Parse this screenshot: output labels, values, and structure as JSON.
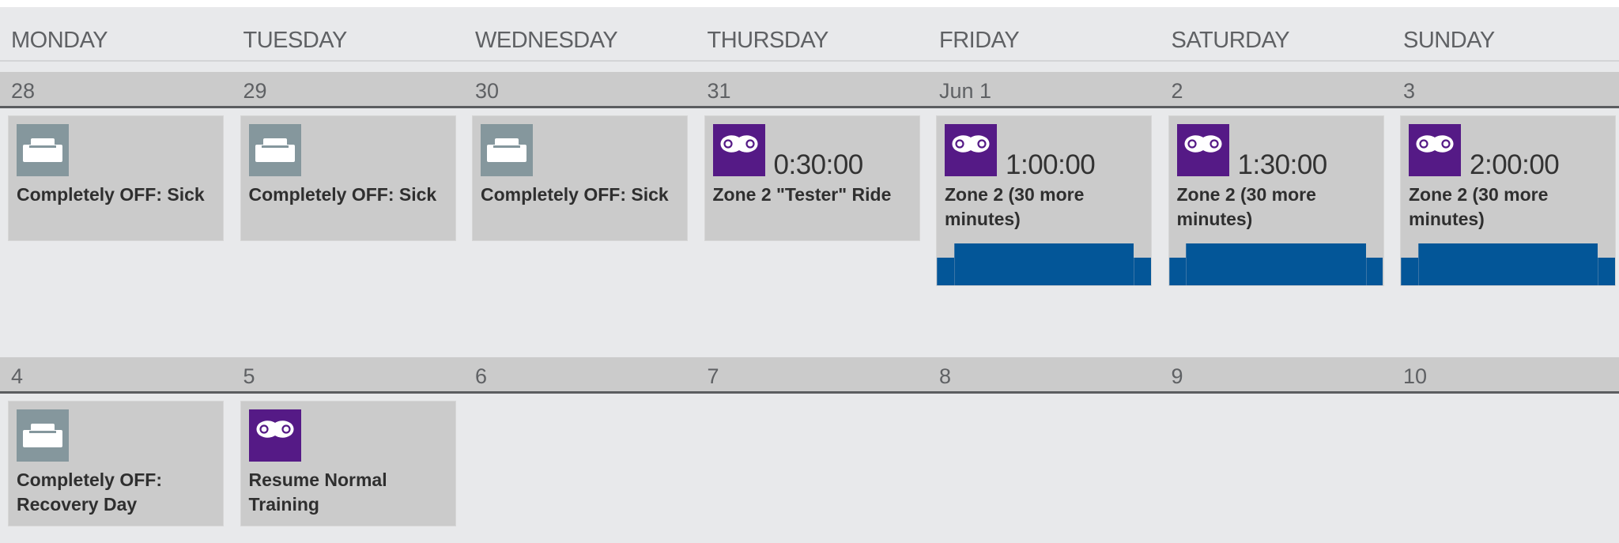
{
  "colors": {
    "rest_icon_bg": "#85979d",
    "bike_icon_bg": "#551a86",
    "workout_graph": "#035698",
    "card_bg": "#cbcbcb",
    "page_bg": "#e8e9eb"
  },
  "header": {
    "days": [
      "MONDAY",
      "TUESDAY",
      "WEDNESDAY",
      "THURSDAY",
      "FRIDAY",
      "SATURDAY",
      "SUNDAY"
    ]
  },
  "weeks": [
    {
      "dates": [
        "28",
        "29",
        "30",
        "31",
        "Jun 1",
        "2",
        "3"
      ],
      "workouts": [
        {
          "day": 0,
          "type": "rest",
          "icon": "couch-icon",
          "duration": "",
          "title": "Completely OFF: Sick",
          "graph": null
        },
        {
          "day": 1,
          "type": "rest",
          "icon": "couch-icon",
          "duration": "",
          "title": "Completely OFF: Sick",
          "graph": null
        },
        {
          "day": 2,
          "type": "rest",
          "icon": "couch-icon",
          "duration": "",
          "title": "Completely OFF: Sick",
          "graph": null
        },
        {
          "day": 3,
          "type": "bike",
          "icon": "bike-chain-icon",
          "duration": "0:30:00",
          "title": "Zone 2 \"Tester\" Ride",
          "graph": null
        },
        {
          "day": 4,
          "type": "bike",
          "icon": "bike-chain-icon",
          "duration": "1:00:00",
          "title": "Zone 2 (30 more minutes)",
          "graph": [
            {
              "start": 0,
              "end": 0.08,
              "intensity": 0.5
            },
            {
              "start": 0.08,
              "end": 0.92,
              "intensity": 0.76
            },
            {
              "start": 0.92,
              "end": 1.0,
              "intensity": 0.5
            }
          ]
        },
        {
          "day": 5,
          "type": "bike",
          "icon": "bike-chain-icon",
          "duration": "1:30:00",
          "title": "Zone 2 (30 more minutes)",
          "graph": [
            {
              "start": 0,
              "end": 0.08,
              "intensity": 0.5
            },
            {
              "start": 0.08,
              "end": 0.92,
              "intensity": 0.76
            },
            {
              "start": 0.92,
              "end": 1.0,
              "intensity": 0.5
            }
          ]
        },
        {
          "day": 6,
          "type": "bike",
          "icon": "bike-chain-icon",
          "duration": "2:00:00",
          "title": "Zone 2 (30 more minutes)",
          "graph": [
            {
              "start": 0,
              "end": 0.08,
              "intensity": 0.5
            },
            {
              "start": 0.08,
              "end": 0.92,
              "intensity": 0.76
            },
            {
              "start": 0.92,
              "end": 1.0,
              "intensity": 0.5
            }
          ]
        }
      ]
    },
    {
      "dates": [
        "4",
        "5",
        "6",
        "7",
        "8",
        "9",
        "10"
      ],
      "workouts": [
        {
          "day": 0,
          "type": "rest",
          "icon": "couch-icon",
          "duration": "",
          "title": "Completely OFF: Recovery Day",
          "graph": null
        },
        {
          "day": 1,
          "type": "bike",
          "icon": "bike-chain-icon",
          "duration": "",
          "title": "Resume Normal Training",
          "graph": null
        }
      ]
    }
  ]
}
